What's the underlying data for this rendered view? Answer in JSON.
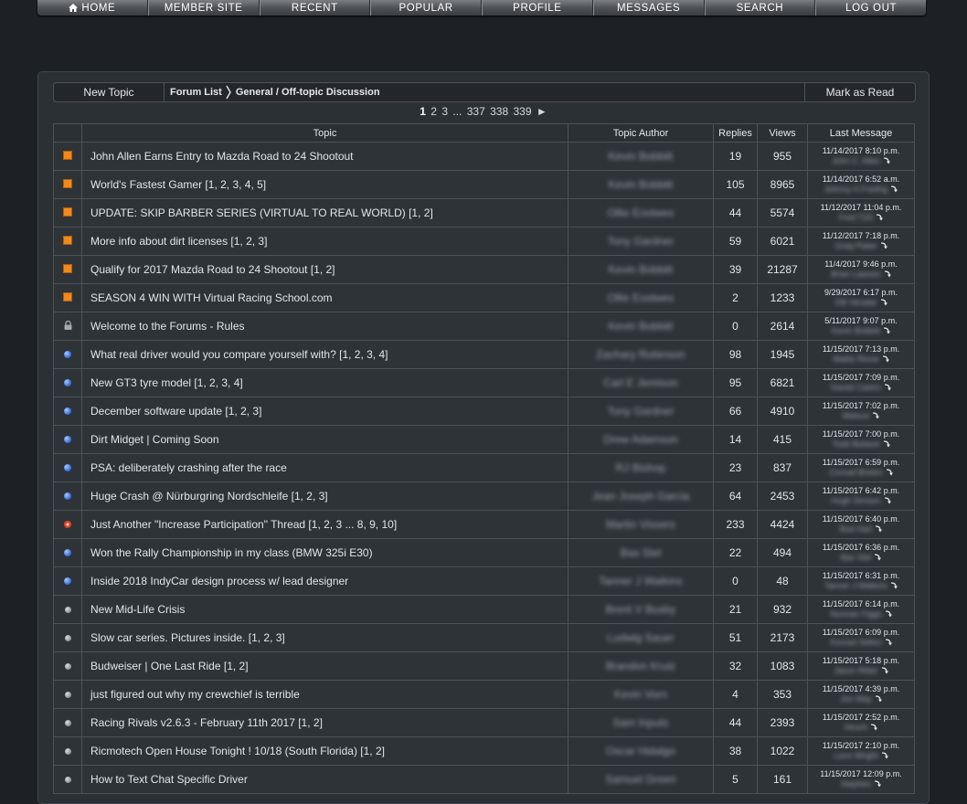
{
  "nav": [
    "Home",
    "Member Site",
    "Recent",
    "Popular",
    "Profile",
    "Messages",
    "Search",
    "Log Out"
  ],
  "toolbar": {
    "new_topic": "New Topic",
    "crumb_root": "Forum List",
    "crumb_current": "General / Off-topic Discussion",
    "mark_read": "Mark as Read"
  },
  "pager": {
    "current": "1",
    "p2": "2",
    "p3": "3",
    "dots": "...",
    "p337": "337",
    "p338": "338",
    "p339": "339",
    "next": "►"
  },
  "columns": {
    "topic": "Topic",
    "author": "Topic Author",
    "replies": "Replies",
    "views": "Views",
    "last": "Last Message"
  },
  "icon_colors": {
    "sticky": "#f08a1c",
    "new": "#3d74e0",
    "read": "#8f9397",
    "hot": "#e53a1a"
  },
  "topics": [
    {
      "icon": "sticky",
      "title": "John Allen Earns Entry to Mazda Road to 24 Shootout",
      "author": "Kevin Bobbitt",
      "replies": "19",
      "views": "955",
      "last_date": "11/14/2017 8:10 p.m.",
      "last_by": "John C. Allen"
    },
    {
      "icon": "sticky",
      "title": "World's Fastest Gamer [1, 2, 3, 4, 5]",
      "author": "Kevin Bobbitt",
      "replies": "105",
      "views": "8965",
      "last_date": "11/14/2017 6:52 a.m.",
      "last_by": "Johnny H Fredrig"
    },
    {
      "icon": "sticky",
      "title": "UPDATE: SKIP BARBER SERIES (VIRTUAL TO REAL WORLD) [1, 2]",
      "author": "Ollie Eostwes",
      "replies": "44",
      "views": "5574",
      "last_date": "11/12/2017 11:04 p.m.",
      "last_by": "Fred T2S"
    },
    {
      "icon": "sticky",
      "title": "More info about dirt licenses [1, 2, 3]",
      "author": "Tony Gardner",
      "replies": "59",
      "views": "6021",
      "last_date": "11/12/2017 7:18 p.m.",
      "last_by": "Greg Plater"
    },
    {
      "icon": "sticky",
      "title": "Qualify for 2017 Mazda Road to 24 Shootout [1, 2]",
      "author": "Kevin Bobbitt",
      "replies": "39",
      "views": "21287",
      "last_date": "11/4/2017 9:46 p.m.",
      "last_by": "Brian Lawson"
    },
    {
      "icon": "sticky",
      "title": "SEASON 4 WIN WITH Virtual Racing School.com",
      "author": "Ollie Eostwes",
      "replies": "2",
      "views": "1233",
      "last_date": "9/29/2017 6:17 p.m.",
      "last_by": "Olli Venalar"
    },
    {
      "icon": "lock",
      "title": "Welcome to the Forums - Rules",
      "author": "Kevin Bobbitt",
      "replies": "0",
      "views": "2614",
      "last_date": "5/11/2017 9:07 p.m.",
      "last_by": "Kevin Bobbitt"
    },
    {
      "icon": "new",
      "title": "What real driver would you compare yourself with? [1, 2, 3, 4]",
      "author": "Zachary Robinson",
      "replies": "98",
      "views": "1945",
      "last_date": "11/15/2017 7:13 p.m.",
      "last_by": "Mattis Rinne"
    },
    {
      "icon": "new",
      "title": "New GT3 tyre model [1, 2, 3, 4]",
      "author": "Carl E Jemison",
      "replies": "95",
      "views": "6821",
      "last_date": "11/15/2017 7:09 p.m.",
      "last_by": "Daniel Castro"
    },
    {
      "icon": "new",
      "title": "December software update [1, 2, 3]",
      "author": "Tony Gardner",
      "replies": "66",
      "views": "4910",
      "last_date": "11/15/2017 7:02 p.m.",
      "last_by": "Matsuo"
    },
    {
      "icon": "new",
      "title": "Dirt Midget | Coming Soon",
      "author": "Drew Adamson",
      "replies": "14",
      "views": "415",
      "last_date": "11/15/2017 7:00 p.m.",
      "last_by": "Todd Bobeck"
    },
    {
      "icon": "new",
      "title": "PSA: deliberately crashing after the race",
      "author": "RJ Bishop",
      "replies": "23",
      "views": "837",
      "last_date": "11/15/2017 6:59 p.m.",
      "last_by": "Conrad Breton"
    },
    {
      "icon": "new",
      "title": "Huge Crash @ Nürburgring Nordschleife [1, 2, 3]",
      "author": "Jean Joseph Garcia",
      "replies": "64",
      "views": "2453",
      "last_date": "11/15/2017 6:42 p.m.",
      "last_by": "Hugh Simson"
    },
    {
      "icon": "hot",
      "title": "Just Another \"Increase Participation\" Thread [1, 2, 3 ... 8, 9, 10]",
      "author": "Martin Vissers",
      "replies": "233",
      "views": "4424",
      "last_date": "11/15/2017 6:40 p.m.",
      "last_by": "Bud Hart"
    },
    {
      "icon": "new",
      "title": "Won the Rally Championship in my class (BMW 325i E30)",
      "author": "Bas Stel",
      "replies": "22",
      "views": "494",
      "last_date": "11/15/2017 6:36 p.m.",
      "last_by": "Bas Stel"
    },
    {
      "icon": "new",
      "title": "Inside 2018 IndyCar design process w/ lead designer",
      "author": "Tanner J Watkins",
      "replies": "0",
      "views": "48",
      "last_date": "11/15/2017 6:31 p.m.",
      "last_by": "Tanner J Watkins"
    },
    {
      "icon": "read",
      "title": "New Mid-Life Crisis",
      "author": "Brent V Busby",
      "replies": "21",
      "views": "932",
      "last_date": "11/15/2017 6:14 p.m.",
      "last_by": "Norman Figgs"
    },
    {
      "icon": "read",
      "title": "Slow car series. Pictures inside. [1, 2, 3]",
      "author": "Ludwig Sauer",
      "replies": "51",
      "views": "2173",
      "last_date": "11/15/2017 6:09 p.m.",
      "last_by": "Konrad Sellon"
    },
    {
      "icon": "read",
      "title": "Budweiser | One Last Ride [1, 2]",
      "author": "Brandon Kruiz",
      "replies": "32",
      "views": "1083",
      "last_date": "11/15/2017 5:18 p.m.",
      "last_by": "Jason Ritter"
    },
    {
      "icon": "read",
      "title": "just figured out why my crewchief is terrible",
      "author": "Kevin Vorn",
      "replies": "4",
      "views": "353",
      "last_date": "11/15/2017 4:39 p.m.",
      "last_by": "Jon Way"
    },
    {
      "icon": "read",
      "title": "Racing Rivals v2.6.3 - February 11th 2017 [1, 2]",
      "author": "Sam Inputs",
      "replies": "44",
      "views": "2393",
      "last_date": "11/15/2017 2:52 p.m.",
      "last_by": "Hirsch"
    },
    {
      "icon": "read",
      "title": "Ricmotech Open House Tonight ! 10/18 (South Florida) [1, 2]",
      "author": "Oscar Hidalgo",
      "replies": "38",
      "views": "1022",
      "last_date": "11/15/2017 2:10 p.m.",
      "last_by": "Leon Wright"
    },
    {
      "icon": "read",
      "title": "How to Text Chat Specific Driver",
      "author": "Samuel Green",
      "replies": "5",
      "views": "161",
      "last_date": "11/15/2017 12:09 p.m.",
      "last_by": "Stephen"
    }
  ]
}
